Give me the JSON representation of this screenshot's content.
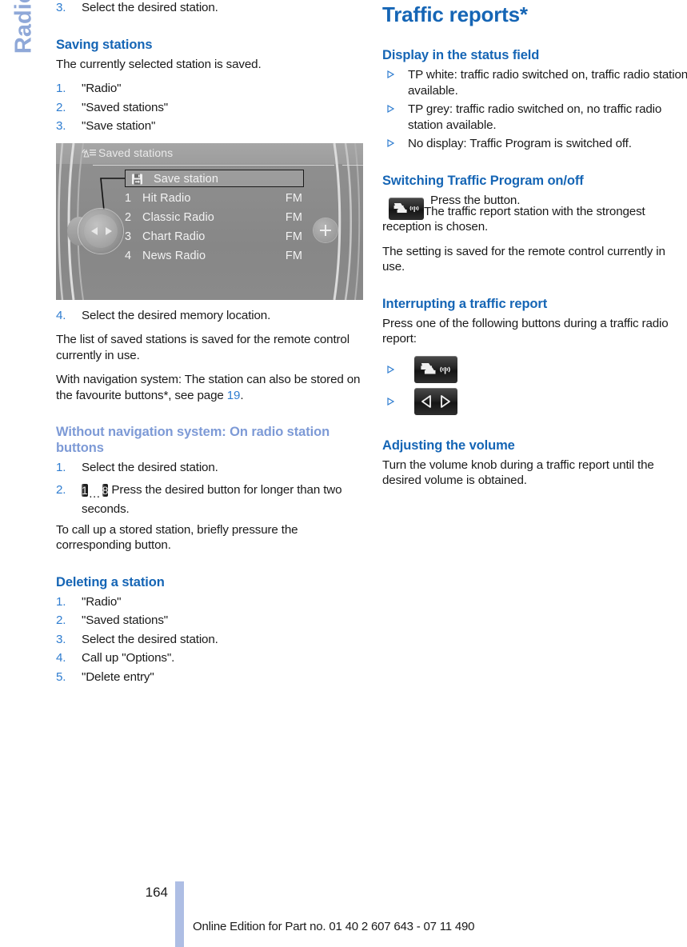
{
  "side_tab": {
    "label": "Radio"
  },
  "colors": {
    "heading_blue": "#1565b5",
    "light_blue": "#7d9ad6",
    "number_blue": "#2f7dd0",
    "footer_bar": "#aebee4"
  },
  "left_column": {
    "top_step": {
      "num": "3.",
      "text": "Select the desired station."
    },
    "saving_stations": {
      "heading": "Saving stations",
      "intro": "The currently selected station is saved.",
      "steps": [
        {
          "num": "1.",
          "text": "\"Radio\""
        },
        {
          "num": "2.",
          "text": "\"Saved stations\""
        },
        {
          "num": "3.",
          "text": "\"Save station\""
        }
      ],
      "after_steps": [
        {
          "num": "4.",
          "text": "Select the desired memory location."
        }
      ],
      "para1": "The list of saved stations is saved for the remote control currently in use.",
      "para2_pre": "With navigation system: The station can also be stored on the favourite buttons*, see page ",
      "para2_link": "19",
      "para2_post": "."
    },
    "idrive": {
      "header_title": "Saved stations",
      "header_icon": "antenna-list-icon",
      "selected_row": {
        "icon": "floppy-disk-icon",
        "label": "Save station"
      },
      "rows": [
        {
          "index": "1",
          "name": "Hit Radio",
          "band": "FM"
        },
        {
          "index": "2",
          "name": "Classic Radio",
          "band": "FM"
        },
        {
          "index": "3",
          "name": "Chart Radio",
          "band": "FM"
        },
        {
          "index": "4",
          "name": "News Radio",
          "band": "FM"
        }
      ],
      "controller_icon": "idrive-controller-icon",
      "plus_button_icon": "plus-icon"
    },
    "without_nav": {
      "heading": "Without navigation system: On radio station buttons",
      "steps": [
        {
          "num": "1.",
          "text": "Select the desired station."
        }
      ],
      "step2": {
        "num": "2.",
        "button_first": "1",
        "dots": "…",
        "button_last": "8",
        "text": "Press the desired button for longer than two seconds."
      },
      "para": "To call up a stored station, briefly pressure the corresponding button."
    },
    "deleting": {
      "heading": "Deleting a station",
      "steps": [
        {
          "num": "1.",
          "text": "\"Radio\""
        },
        {
          "num": "2.",
          "text": "\"Saved stations\""
        },
        {
          "num": "3.",
          "text": "Select the desired station."
        },
        {
          "num": "4.",
          "text": "Call up \"Options\"."
        },
        {
          "num": "5.",
          "text": "\"Delete entry\""
        }
      ]
    }
  },
  "right_column": {
    "title": "Traffic reports*",
    "display_status": {
      "heading": "Display in the status field",
      "bullets": [
        "TP white: traffic radio switched on, traffic radio station available.",
        "TP grey: traffic radio switched on, no traffic radio station available.",
        "No display: Traffic Program is switched off."
      ]
    },
    "switching_tp": {
      "heading": "Switching Traffic Program on/off",
      "button_icon": "traffic-program-button-icon",
      "line1": "Press the button.",
      "line2": "The traffic report station with the strongest reception is chosen.",
      "para": "The setting is saved for the remote control currently in use."
    },
    "interrupting": {
      "heading": "Interrupting a traffic report",
      "intro": "Press one of the following buttons during a traffic radio report:",
      "bullets": [
        {
          "icon": "traffic-program-button-icon"
        },
        {
          "icon": "seek-left-right-button-icon"
        }
      ]
    },
    "volume": {
      "heading": "Adjusting the volume",
      "para": "Turn the volume knob during a traffic report until the desired volume is obtained."
    }
  },
  "footer": {
    "page_number": "164",
    "edition": "Online Edition for Part no. 01 40 2 607 643 - 07 11 490"
  }
}
